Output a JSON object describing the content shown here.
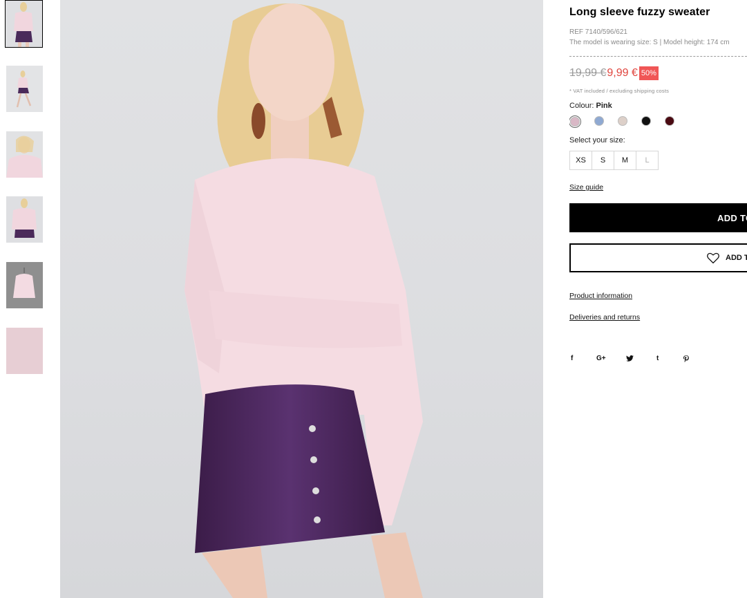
{
  "product": {
    "title": "Long sleeve fuzzy sweater",
    "ref": "REF 7140/596/621",
    "model_info": "The model is wearing size: S | Model height: 174 cm",
    "old_price": "19,99 €",
    "new_price": "9,99 €",
    "discount": "50%",
    "vat_note": "* VAT included / excluding shipping costs"
  },
  "colour": {
    "label": "Colour:",
    "selected": "Pink",
    "swatches": [
      {
        "name": "pink",
        "hex": "#d9b8c6"
      },
      {
        "name": "blue",
        "hex": "#8fa9d2"
      },
      {
        "name": "beige",
        "hex": "#ddd0c9"
      },
      {
        "name": "black",
        "hex": "#111111"
      },
      {
        "name": "burgundy",
        "hex": "#4a0a12"
      }
    ]
  },
  "sizes": {
    "label": "Select your size:",
    "options": [
      {
        "label": "XS",
        "available": true
      },
      {
        "label": "S",
        "available": true
      },
      {
        "label": "M",
        "available": true
      },
      {
        "label": "L",
        "available": false
      }
    ],
    "guide": "Size guide"
  },
  "actions": {
    "add_to_cart": "ADD TO",
    "add_to_wishlist": "ADD T"
  },
  "links": {
    "product_info": "Product information",
    "deliveries": "Deliveries and returns"
  },
  "social": [
    "f",
    "G+",
    "twitter-icon",
    "t",
    "pinterest-icon"
  ],
  "thumbnails": [
    "thumb-1",
    "thumb-2",
    "thumb-3",
    "thumb-4",
    "thumb-5",
    "thumb-6"
  ]
}
